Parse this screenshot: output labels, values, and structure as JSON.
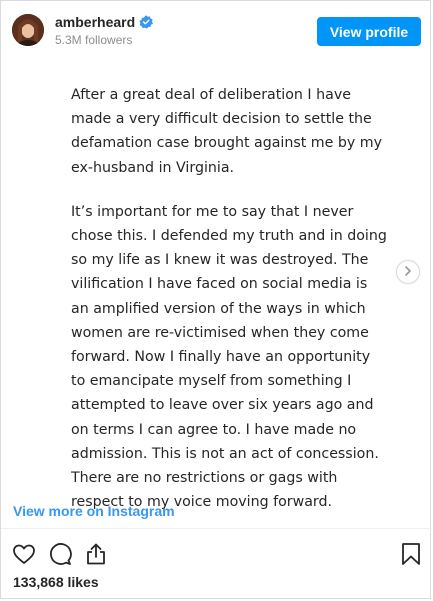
{
  "header": {
    "username": "amberheard",
    "followers": "5.3M followers",
    "view_profile_label": "View profile"
  },
  "post": {
    "paragraphs": [
      "After a great deal of deliberation I have made a very difficult decision to settle the defamation case brought against me by my ex-husband in Virginia.",
      "It’s important for me to say that I never chose this. I defended my truth and in doing so my life as I knew it was destroyed. The vilification I have faced on social media is an amplified version of the ways in which women are re-victimised when they come forward.  Now I finally have an opportunity to emancipate myself from something I attempted to leave over six years ago and on terms I can agree to. I have made no admission. This is not an act of concession. There are no restrictions or gags with respect to my voice moving forward."
    ]
  },
  "footer": {
    "view_more_label": "View more on Instagram",
    "likes": "133,868 likes"
  },
  "icons": {
    "verified": "verified-badge-icon",
    "next": "chevron-right-icon",
    "like": "heart-icon",
    "comment": "comment-icon",
    "share": "share-icon",
    "save": "bookmark-icon"
  },
  "colors": {
    "accent": "#0095f6",
    "link": "#3897f0",
    "text": "#262626",
    "muted": "#8e8e8e",
    "border": "#dbdbdb"
  }
}
